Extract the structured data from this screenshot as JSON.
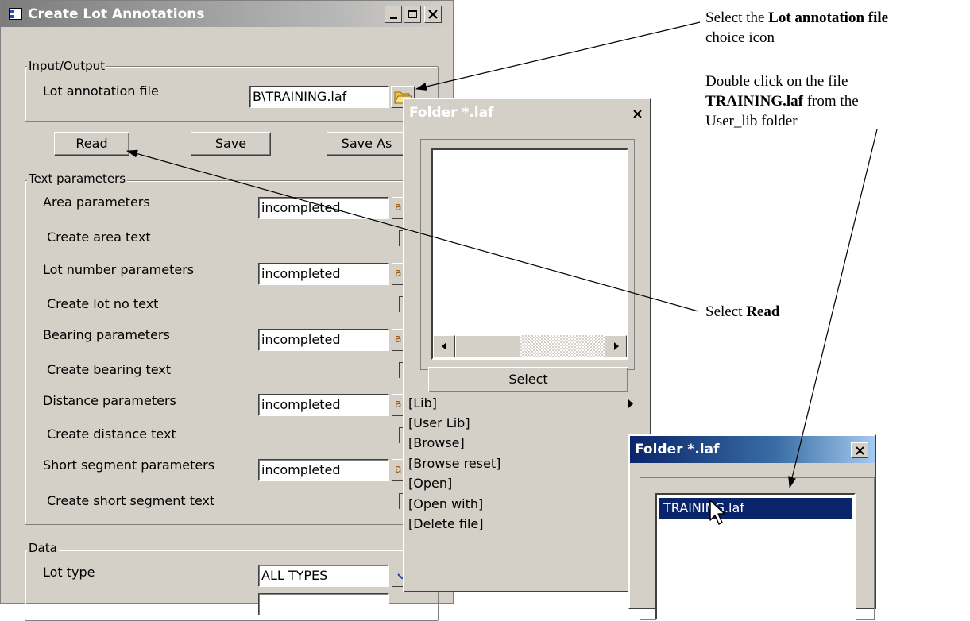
{
  "main_window": {
    "title": "Create Lot Annotations",
    "io_group": {
      "label": "Input/Output",
      "file_label": "Lot annotation file",
      "file_value": "B\\TRAINING.laf"
    },
    "buttons": {
      "read": "Read",
      "save": "Save",
      "save_as": "Save As"
    },
    "text_group": {
      "label": "Text parameters",
      "rows": [
        {
          "label": "Area parameters",
          "value": "incompleted"
        },
        {
          "label": "Create area text"
        },
        {
          "label": "Lot number parameters",
          "value": "incompleted"
        },
        {
          "label": "Create lot no text"
        },
        {
          "label": "Bearing parameters",
          "value": "incompleted"
        },
        {
          "label": "Create bearing text"
        },
        {
          "label": "Distance parameters",
          "value": "incompleted"
        },
        {
          "label": "Create distance text"
        },
        {
          "label": "Short segment parameters",
          "value": "incompleted"
        },
        {
          "label": "Create short segment text"
        }
      ]
    },
    "data_group": {
      "label": "Data",
      "lot_type_label": "Lot type",
      "lot_type_value": "ALL TYPES"
    }
  },
  "folder_popup": {
    "title": "Folder *.laf",
    "select_label": "Select",
    "menu_items": [
      "[Lib]",
      "[User Lib]",
      "[Browse]",
      "[Browse reset]",
      "[Open]",
      "[Open with]",
      "[Delete file]"
    ]
  },
  "folder_popup_2": {
    "title": "Folder *.laf",
    "selected_file": "TRAINING.laf"
  },
  "callouts": {
    "c1_pre": "Select the ",
    "c1_bold": "Lot annotation file",
    "c1_post": "choice icon",
    "c2_line1": "Double click on the file",
    "c2_bold": "TRAINING.laf",
    "c2_mid": " from the",
    "c2_line3": "User_lib folder",
    "c3_pre": "Select ",
    "c3_bold": "Read"
  },
  "colors": {
    "dialog_bg": "#d4d0c8",
    "title_active": "#0a246a",
    "title_inactive": "#808080",
    "selection": "#0a246a"
  }
}
